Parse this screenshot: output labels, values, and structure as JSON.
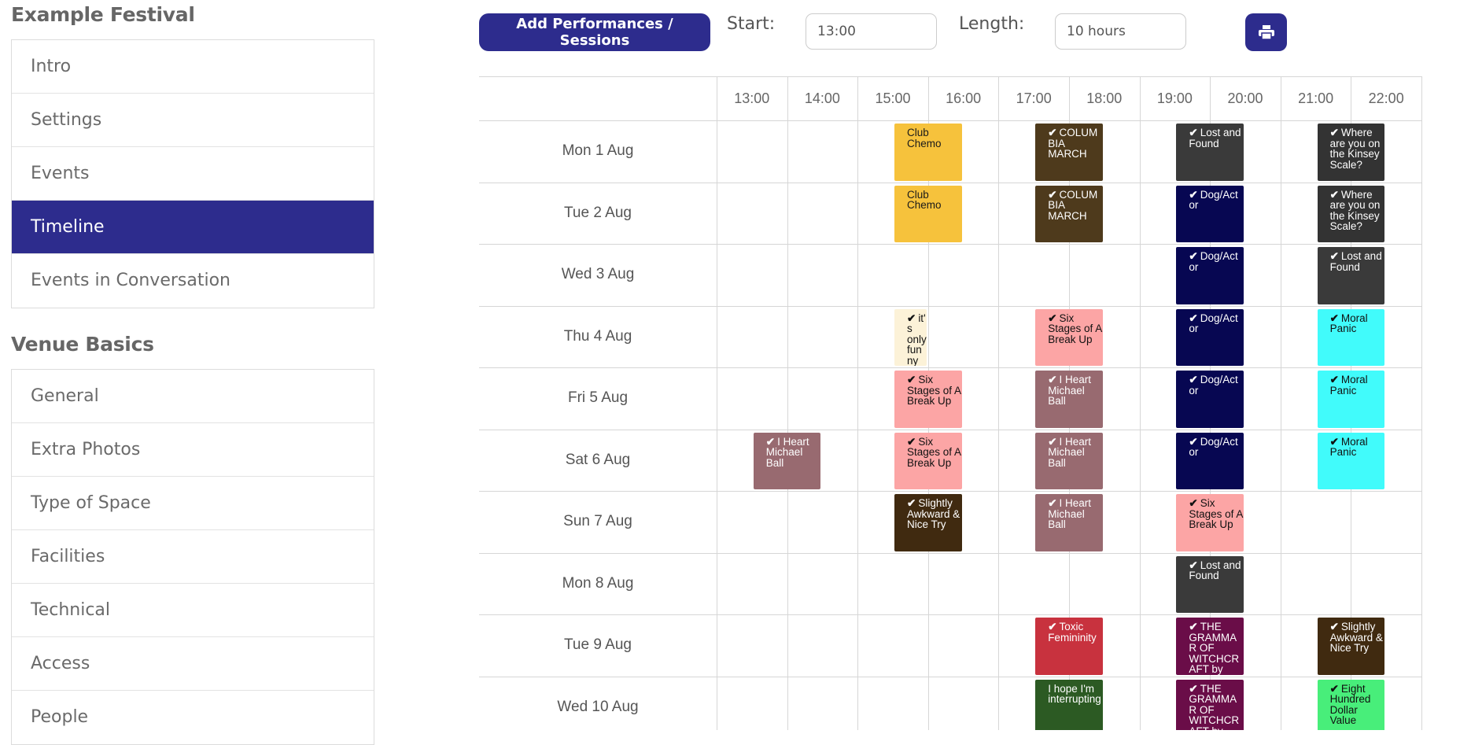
{
  "sidebar": {
    "festival_title": "Example Festival",
    "festival_items": [
      {
        "label": "Intro",
        "active": false
      },
      {
        "label": "Settings",
        "active": false
      },
      {
        "label": "Events",
        "active": false
      },
      {
        "label": "Timeline",
        "active": true
      },
      {
        "label": "Events in Conversation",
        "active": false
      }
    ],
    "venue_title": "Venue Basics",
    "venue_items": [
      {
        "label": "General"
      },
      {
        "label": "Extra Photos"
      },
      {
        "label": "Type of Space"
      },
      {
        "label": "Facilities"
      },
      {
        "label": "Technical"
      },
      {
        "label": "Access"
      },
      {
        "label": "People"
      }
    ]
  },
  "toolbar": {
    "add_label": "Add Performances / Sessions",
    "start_label": "Start:",
    "start_value": "13:00",
    "length_label": "Length:",
    "length_value": "10 hours",
    "print_icon": "print-icon"
  },
  "timeline": {
    "hours": [
      "13:00",
      "14:00",
      "15:00",
      "16:00",
      "17:00",
      "18:00",
      "19:00",
      "20:00",
      "21:00",
      "22:00"
    ],
    "days": [
      "Mon 1 Aug",
      "Tue 2 Aug",
      "Wed 3 Aug",
      "Thu 4 Aug",
      "Fri 5 Aug",
      "Sat 6 Aug",
      "Sun 7 Aug",
      "Mon 8 Aug",
      "Tue 9 Aug",
      "Wed 10 Aug"
    ],
    "performances": [
      {
        "day": 0,
        "start": "15:30",
        "end": "16:30",
        "title": "Club Chemo",
        "check": false,
        "bg": "#f6c23c",
        "fg": "#1a1a1a"
      },
      {
        "day": 0,
        "start": "17:30",
        "end": "18:30",
        "title": "COLUMBIA MARCH",
        "check": true,
        "bg": "#4e3a1c",
        "fg": "#ffffff"
      },
      {
        "day": 0,
        "start": "19:30",
        "end": "20:30",
        "title": "Lost and Found",
        "check": true,
        "bg": "#3a3a3a",
        "fg": "#ffffff"
      },
      {
        "day": 0,
        "start": "21:30",
        "end": "22:30",
        "title": "Where are you on the Kinsey Scale?",
        "check": true,
        "bg": "#333333",
        "fg": "#ffffff"
      },
      {
        "day": 1,
        "start": "15:30",
        "end": "16:30",
        "title": "Club Chemo",
        "check": false,
        "bg": "#f6c23c",
        "fg": "#1a1a1a"
      },
      {
        "day": 1,
        "start": "17:30",
        "end": "18:30",
        "title": "COLUMBIA MARCH",
        "check": true,
        "bg": "#4e3a1c",
        "fg": "#ffffff"
      },
      {
        "day": 1,
        "start": "19:30",
        "end": "20:30",
        "title": "Dog/Actor",
        "check": true,
        "bg": "#070752",
        "fg": "#ffffff"
      },
      {
        "day": 1,
        "start": "21:30",
        "end": "22:30",
        "title": "Where are you on the Kinsey Scale?",
        "check": true,
        "bg": "#333333",
        "fg": "#ffffff"
      },
      {
        "day": 2,
        "start": "19:30",
        "end": "20:30",
        "title": "Dog/Actor",
        "check": true,
        "bg": "#070752",
        "fg": "#ffffff"
      },
      {
        "day": 2,
        "start": "21:30",
        "end": "22:30",
        "title": "Lost and Found",
        "check": true,
        "bg": "#3a3a3a",
        "fg": "#ffffff"
      },
      {
        "day": 3,
        "start": "15:30",
        "end": "16:00",
        "title": "it's only funny with",
        "check": true,
        "bg": "#fcf2d8",
        "fg": "#111111"
      },
      {
        "day": 3,
        "start": "17:30",
        "end": "18:30",
        "title": "Six Stages of A Break Up",
        "check": true,
        "bg": "#fca5a5",
        "fg": "#111111"
      },
      {
        "day": 3,
        "start": "19:30",
        "end": "20:30",
        "title": "Dog/Actor",
        "check": true,
        "bg": "#070752",
        "fg": "#ffffff"
      },
      {
        "day": 3,
        "start": "21:30",
        "end": "22:30",
        "title": "Moral Panic",
        "check": true,
        "bg": "#41fbfb",
        "fg": "#111111"
      },
      {
        "day": 4,
        "start": "15:30",
        "end": "16:30",
        "title": "Six Stages of A Break Up",
        "check": true,
        "bg": "#fca5a5",
        "fg": "#111111"
      },
      {
        "day": 4,
        "start": "17:30",
        "end": "18:30",
        "title": "I Heart Michael Ball",
        "check": true,
        "bg": "#986a70",
        "fg": "#ffffff"
      },
      {
        "day": 4,
        "start": "19:30",
        "end": "20:30",
        "title": "Dog/Actor",
        "check": true,
        "bg": "#070752",
        "fg": "#ffffff"
      },
      {
        "day": 4,
        "start": "21:30",
        "end": "22:30",
        "title": "Moral Panic",
        "check": true,
        "bg": "#41fbfb",
        "fg": "#111111"
      },
      {
        "day": 5,
        "start": "13:30",
        "end": "14:30",
        "title": "I Heart Michael Ball",
        "check": true,
        "bg": "#986a70",
        "fg": "#ffffff"
      },
      {
        "day": 5,
        "start": "15:30",
        "end": "16:30",
        "title": "Six Stages of A Break Up",
        "check": true,
        "bg": "#fca5a5",
        "fg": "#111111"
      },
      {
        "day": 5,
        "start": "17:30",
        "end": "18:30",
        "title": "I Heart Michael Ball",
        "check": true,
        "bg": "#986a70",
        "fg": "#ffffff"
      },
      {
        "day": 5,
        "start": "19:30",
        "end": "20:30",
        "title": "Dog/Actor",
        "check": true,
        "bg": "#070752",
        "fg": "#ffffff"
      },
      {
        "day": 5,
        "start": "21:30",
        "end": "22:30",
        "title": "Moral Panic",
        "check": true,
        "bg": "#41fbfb",
        "fg": "#111111"
      },
      {
        "day": 6,
        "start": "15:30",
        "end": "16:30",
        "title": "Slightly Awkward & Nice Try",
        "check": true,
        "bg": "#402a10",
        "fg": "#ffffff"
      },
      {
        "day": 6,
        "start": "17:30",
        "end": "18:30",
        "title": "I Heart Michael Ball",
        "check": true,
        "bg": "#986a70",
        "fg": "#ffffff"
      },
      {
        "day": 6,
        "start": "19:30",
        "end": "20:30",
        "title": "Six Stages of A Break Up",
        "check": true,
        "bg": "#fca5a5",
        "fg": "#111111"
      },
      {
        "day": 7,
        "start": "19:30",
        "end": "20:30",
        "title": "Lost and Found",
        "check": true,
        "bg": "#3a3a3a",
        "fg": "#ffffff"
      },
      {
        "day": 8,
        "start": "17:30",
        "end": "18:30",
        "title": "Toxic Femininity",
        "check": true,
        "bg": "#c8323e",
        "fg": "#ffffff"
      },
      {
        "day": 8,
        "start": "19:30",
        "end": "20:30",
        "title": "THE GRAMMAR OF WITCHCRAFT by David",
        "check": true,
        "bg": "#6a0d48",
        "fg": "#ffffff"
      },
      {
        "day": 8,
        "start": "21:30",
        "end": "22:30",
        "title": "Slightly Awkward & Nice Try",
        "check": true,
        "bg": "#402a10",
        "fg": "#ffffff"
      },
      {
        "day": 9,
        "start": "17:30",
        "end": "18:30",
        "title": "I hope I'm interrupting",
        "check": false,
        "bg": "#2c5a23",
        "fg": "#ffffff"
      },
      {
        "day": 9,
        "start": "19:30",
        "end": "20:30",
        "title": "THE GRAMMAR OF WITCHCRAFT by David",
        "check": true,
        "bg": "#6a0d48",
        "fg": "#ffffff"
      },
      {
        "day": 9,
        "start": "21:30",
        "end": "22:30",
        "title": "Eight Hundred Dollar Value",
        "check": true,
        "bg": "#48ee7a",
        "fg": "#111111"
      }
    ]
  }
}
